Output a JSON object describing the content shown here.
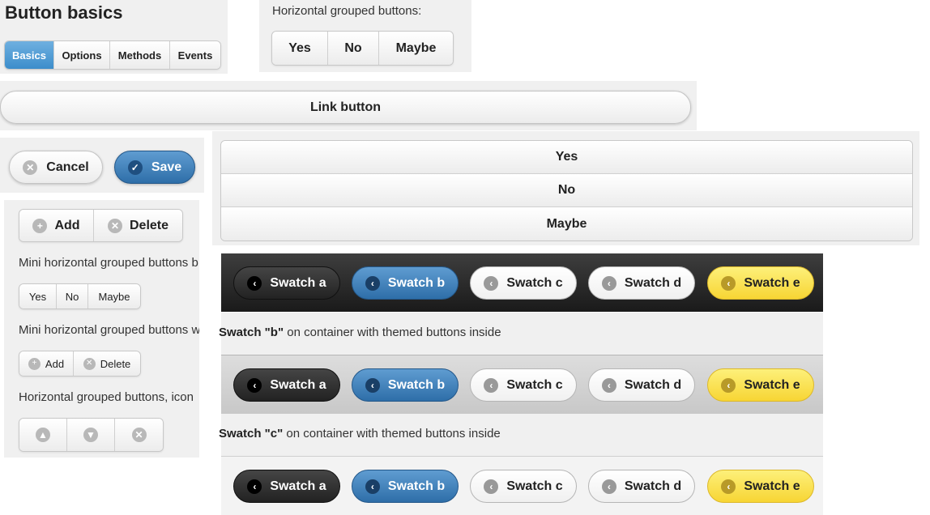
{
  "page": {
    "title": "Button basics"
  },
  "tabs": [
    "Basics",
    "Options",
    "Methods",
    "Events"
  ],
  "horizontal_grouped": {
    "label": "Horizontal grouped buttons:",
    "buttons": [
      "Yes",
      "No",
      "Maybe"
    ]
  },
  "link_button": "Link button",
  "cancel_button": {
    "label": "Cancel",
    "icon": "close-icon"
  },
  "save_button": {
    "label": "Save",
    "icon": "check-icon"
  },
  "vertical_grouped": {
    "buttons": [
      "Yes",
      "No",
      "Maybe"
    ]
  },
  "icon_group": {
    "add": {
      "label": "Add",
      "icon": "plus-icon"
    },
    "delete": {
      "label": "Delete",
      "icon": "close-icon"
    }
  },
  "mini_group_label": "Mini horizontal grouped buttons b",
  "mini_group": {
    "buttons": [
      "Yes",
      "No",
      "Maybe"
    ]
  },
  "mini_icon_group_label": "Mini horizontal grouped buttons w",
  "mini_icon_group": {
    "add": {
      "label": "Add",
      "icon": "plus-icon"
    },
    "delete": {
      "label": "Delete",
      "icon": "close-icon"
    }
  },
  "icon_only_group_label": "Horizontal grouped buttons, icon",
  "icon_only_group": {
    "icons": [
      "arrow-up-icon",
      "arrow-down-icon",
      "close-icon"
    ]
  },
  "swatch_buttons": [
    "Swatch a",
    "Swatch b",
    "Swatch c",
    "Swatch d",
    "Swatch e"
  ],
  "swatch_b_caption": {
    "bold": "Swatch \"b\"",
    "rest": " on container with themed buttons inside"
  },
  "swatch_c_caption": {
    "bold": "Swatch \"c\"",
    "rest": " on container with themed buttons inside"
  },
  "colors": {
    "active_tab": "#4a9ad6",
    "save": "#3a7fc0",
    "swatch_a": "#333333",
    "swatch_b": "#3a7fc0",
    "swatch_c": "#f5f5f5",
    "swatch_d": "#f5f5f5",
    "swatch_e": "#fbe25a"
  }
}
